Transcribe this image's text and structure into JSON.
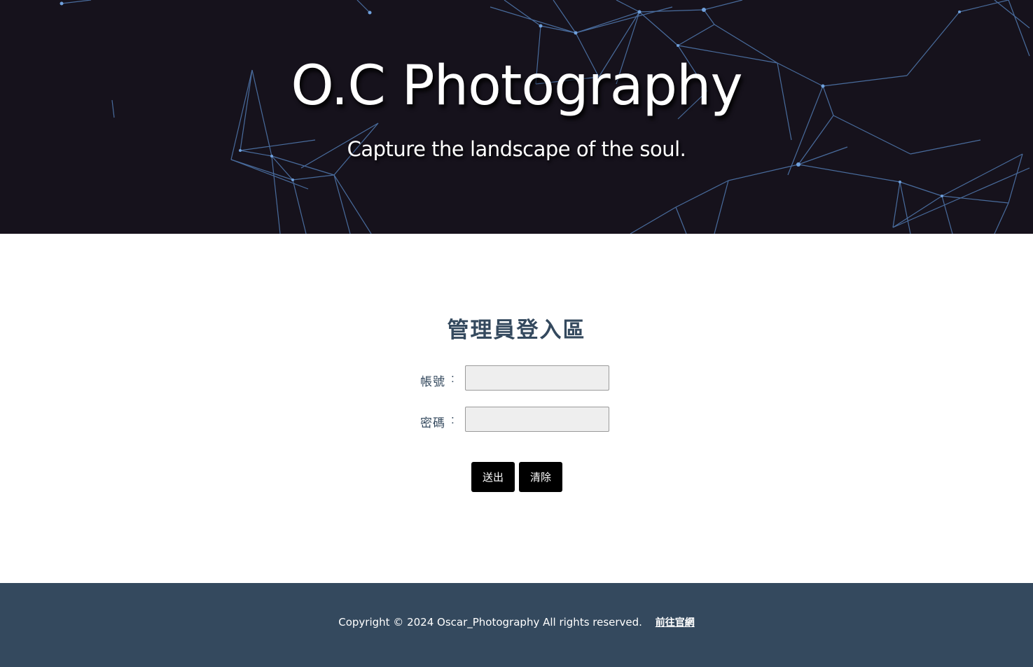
{
  "header": {
    "title": "O.C Photography",
    "subtitle": "Capture the landscape of the soul."
  },
  "login": {
    "heading": "管理員登入區",
    "account_label": "帳號",
    "password_label": "密碼",
    "colon": ":",
    "account_value": "",
    "password_value": "",
    "submit_label": "送出",
    "clear_label": "清除"
  },
  "footer": {
    "copyright": "Copyright © 2024 Oscar_Photography All rights reserved.",
    "link_label": "前往官網"
  },
  "colors": {
    "hero_background": "#16121c",
    "network_lines": "#5a8ac8",
    "heading_text": "#34495e",
    "footer_background": "#34495e",
    "button_background": "#000000",
    "input_background": "#eeeeee"
  }
}
